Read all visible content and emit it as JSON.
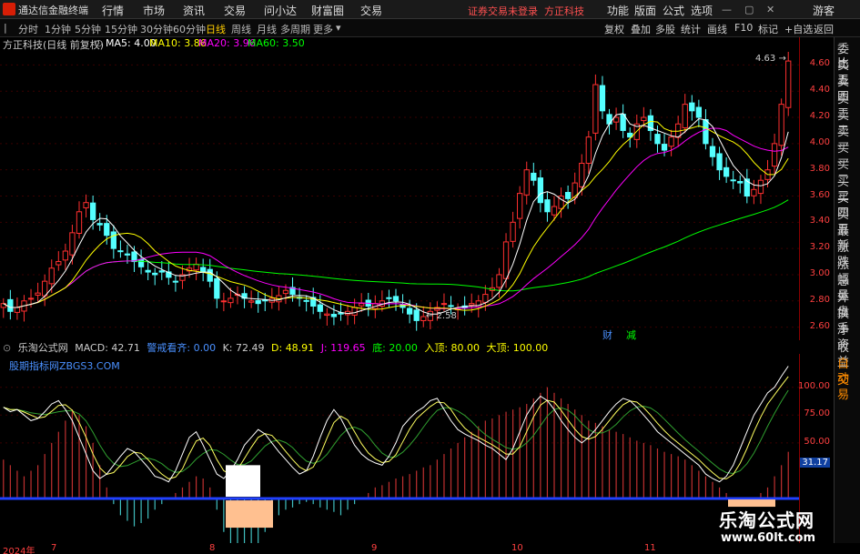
{
  "menubar": {
    "app_title": "通达信金融终端",
    "items": [
      "行情",
      "市场",
      "资讯",
      "交易",
      "问小达",
      "财富圈",
      "交易"
    ],
    "login_status": "证券交易未登录",
    "broker": "方正科技",
    "right_items": [
      "功能",
      "版面",
      "公式",
      "选项"
    ],
    "guest": "游客"
  },
  "toolbar": {
    "periods": [
      "分时",
      "1分钟",
      "5分钟",
      "15分钟",
      "30分钟",
      "60分钟",
      "日线",
      "周线",
      "月线",
      "多周期",
      "更多"
    ],
    "active_period": "日线",
    "right_items": [
      "复权",
      "叠加",
      "多股",
      "统计",
      "画线",
      "F10",
      "标记",
      "+自选",
      "返回"
    ]
  },
  "chart_header": {
    "stock": "方正科技(日线 前复权)",
    "ma5": "MA5: 4.00",
    "ma10": "MA10: 3.86",
    "ma20": "MA20: 3.96",
    "ma60": "MA60: 3.50",
    "colors": {
      "ma5": "#ffffff",
      "ma10": "#ffff00",
      "ma20": "#ff00ff",
      "ma60": "#00ff00"
    }
  },
  "price_axis": [
    "4.60",
    "4.40",
    "4.20",
    "4.00",
    "3.80",
    "3.60",
    "3.40",
    "3.20",
    "3.00",
    "2.80",
    "2.60"
  ],
  "price_marks": {
    "high": "4.63",
    "low": "2.58"
  },
  "tags": {
    "cai": "财",
    "jian": "减"
  },
  "side_panel": [
    "委比",
    "卖五",
    "卖四",
    "卖三",
    "卖二",
    "卖一",
    "买一",
    "买二",
    "买三",
    "买四",
    "买五",
    "最新",
    "涨跌",
    "涨幅",
    "总量",
    "外盘",
    "换手",
    "净资",
    "收益",
    "自动",
    "交易"
  ],
  "sub_header": {
    "name": "乐淘公式网",
    "macd": "MACD: 42.71",
    "alert": "警戒看齐: 0.00",
    "k": "K: 72.49",
    "d": "D: 48.91",
    "j": "J: 119.65",
    "di": "底: 20.00",
    "rudi": "入顶: 80.00",
    "dading": "大顶: 100.00"
  },
  "sub_site": "股期指标网ZBGS3.COM",
  "sub_axis": [
    "100.00",
    "75.00",
    "50.00",
    "31.17"
  ],
  "dates": [
    "2024年",
    "7",
    "8",
    "9",
    "10",
    "11"
  ],
  "watermark": {
    "name": "乐淘公式网",
    "url": "www.60lt.com"
  },
  "chart_data": {
    "type": "candlestick",
    "title": "方正科技(日线 前复权)",
    "ylim": [
      2.5,
      4.7
    ],
    "yticks": [
      2.6,
      2.8,
      3.0,
      3.2,
      3.4,
      3.6,
      3.8,
      4.0,
      4.2,
      4.4,
      4.6
    ],
    "ma_series": [
      {
        "name": "MA5",
        "color": "#ffffff"
      },
      {
        "name": "MA10",
        "color": "#ffff00"
      },
      {
        "name": "MA20",
        "color": "#ff00ff"
      },
      {
        "name": "MA60",
        "color": "#00ff00"
      }
    ],
    "candles_close": [
      2.78,
      2.72,
      2.75,
      2.8,
      2.82,
      2.86,
      2.95,
      3.05,
      3.1,
      3.18,
      3.32,
      3.48,
      3.55,
      3.42,
      3.38,
      3.3,
      3.2,
      3.18,
      3.15,
      3.1,
      3.06,
      3.02,
      3.0,
      3.02,
      2.98,
      2.95,
      3.0,
      3.05,
      3.08,
      3.02,
      2.95,
      2.82,
      2.8,
      2.82,
      2.85,
      2.82,
      2.8,
      2.78,
      2.8,
      2.82,
      2.84,
      2.88,
      2.85,
      2.82,
      2.8,
      2.76,
      2.72,
      2.7,
      2.68,
      2.7,
      2.72,
      2.75,
      2.78,
      2.76,
      2.78,
      2.8,
      2.82,
      2.8,
      2.75,
      2.7,
      2.65,
      2.68,
      2.72,
      2.75,
      2.78,
      2.76,
      2.74,
      2.75,
      2.78,
      2.8,
      2.85,
      2.9,
      3.0,
      3.25,
      3.4,
      3.62,
      3.8,
      3.72,
      3.55,
      3.48,
      3.52,
      3.6,
      3.58,
      3.7,
      3.85,
      4.05,
      4.45,
      4.25,
      4.15,
      4.2,
      4.1,
      4.05,
      4.15,
      4.2,
      4.1,
      4.0,
      3.95,
      4.05,
      4.15,
      4.3,
      4.25,
      4.2,
      4.0,
      3.9,
      3.8,
      3.75,
      3.72,
      3.7,
      3.6,
      3.65,
      3.72,
      3.8,
      4.0,
      4.3,
      4.63
    ],
    "kdj_j": [
      82,
      78,
      80,
      75,
      70,
      72,
      78,
      85,
      88,
      80,
      70,
      55,
      40,
      25,
      18,
      22,
      30,
      38,
      45,
      42,
      35,
      28,
      20,
      18,
      15,
      25,
      40,
      55,
      60,
      48,
      35,
      22,
      18,
      25,
      35,
      48,
      55,
      62,
      58,
      50,
      42,
      35,
      28,
      22,
      25,
      38,
      55,
      70,
      80,
      72,
      60,
      48,
      40,
      35,
      32,
      30,
      38,
      50,
      65,
      72,
      78,
      82,
      88,
      90,
      80,
      70,
      62,
      58,
      55,
      52,
      48,
      45,
      40,
      35,
      45,
      60,
      75,
      85,
      92,
      88,
      80,
      70,
      62,
      55,
      50,
      55,
      62,
      70,
      78,
      85,
      90,
      88,
      82,
      75,
      68,
      60,
      55,
      50,
      45,
      40,
      35,
      30,
      22,
      18,
      15,
      20,
      30,
      45,
      60,
      75,
      85,
      95,
      100,
      110,
      119
    ],
    "macd_hist": [
      35,
      30,
      25,
      20,
      25,
      30,
      40,
      50,
      60,
      70,
      80,
      75,
      65,
      50,
      30,
      10,
      -5,
      -15,
      -20,
      -25,
      -22,
      -18,
      -10,
      -5,
      0,
      5,
      10,
      15,
      20,
      18,
      10,
      -10,
      -30,
      -45,
      -50,
      -55,
      -48,
      -40,
      -30,
      -20,
      -15,
      -10,
      -8,
      -5,
      -3,
      -5,
      -8,
      -10,
      -12,
      -15,
      -10,
      -5,
      0,
      5,
      10,
      12,
      15,
      18,
      20,
      22,
      25,
      28,
      30,
      35,
      40,
      45,
      50,
      55,
      60,
      65,
      70,
      72,
      75,
      78,
      80,
      82,
      85,
      90,
      95,
      100,
      95,
      90,
      85,
      80,
      75,
      70,
      68,
      65,
      62,
      60,
      58,
      55,
      52,
      50,
      48,
      45,
      42,
      40,
      38,
      35,
      30,
      25,
      20,
      15,
      10,
      5,
      0,
      -5,
      -3,
      0,
      5,
      10,
      20,
      30,
      42
    ],
    "sub_ylim": [
      -40,
      130
    ]
  }
}
